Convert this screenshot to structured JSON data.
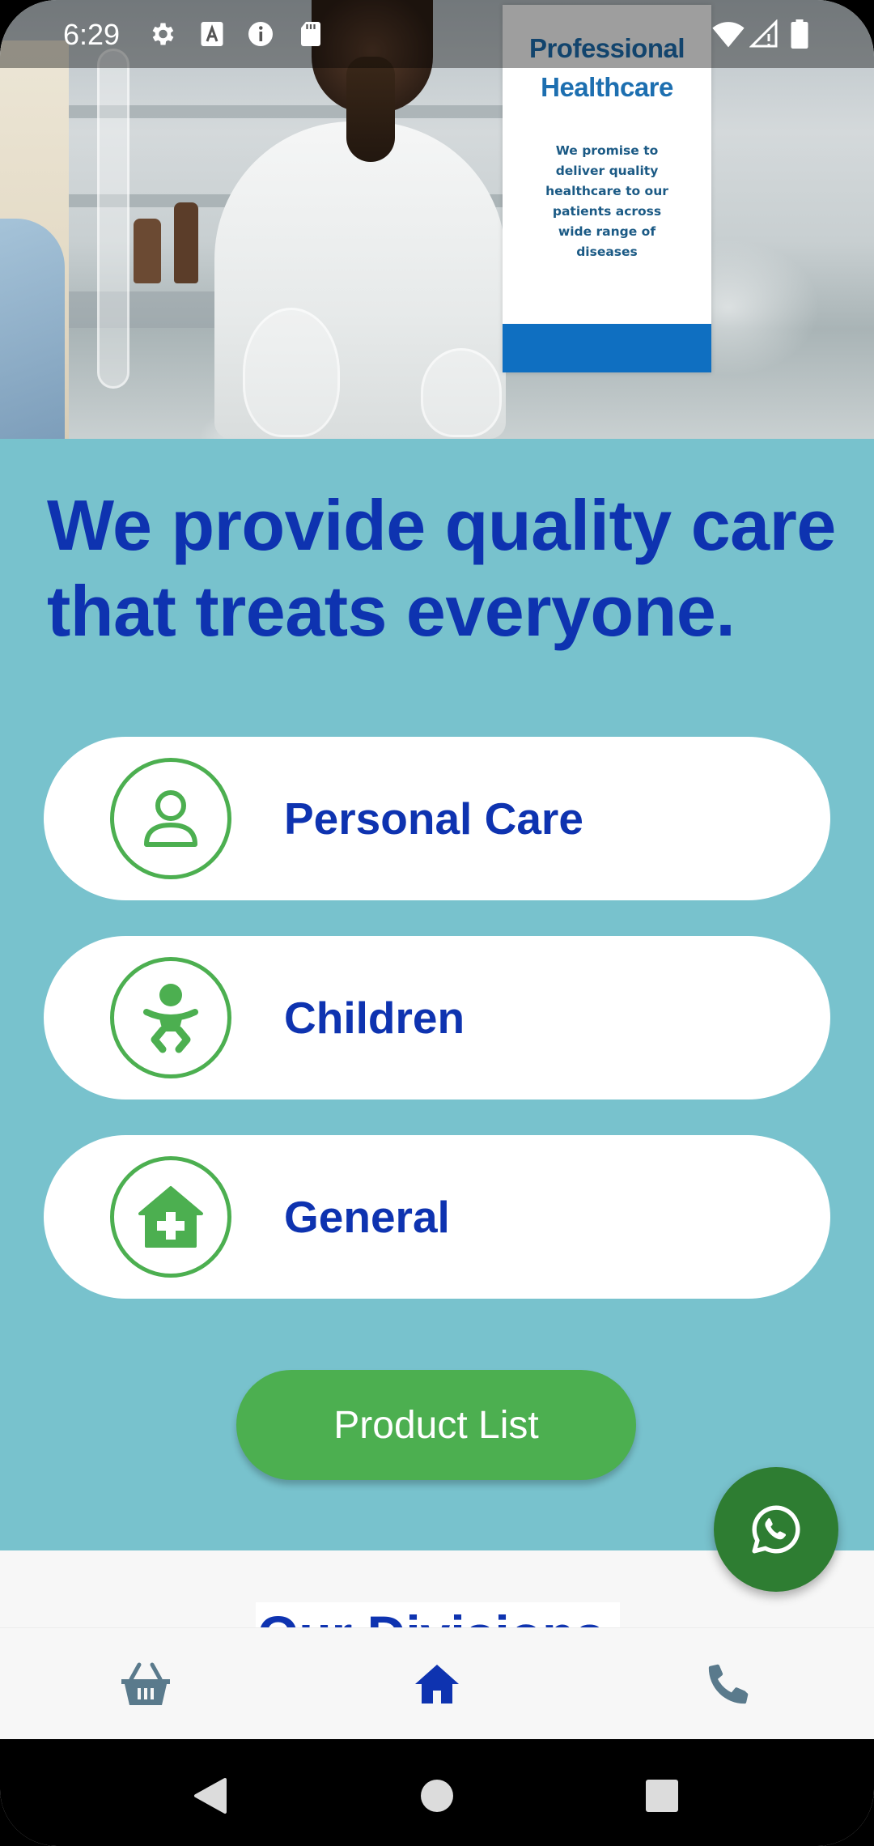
{
  "status_bar": {
    "time": "6:29",
    "icons": [
      "gear-icon",
      "a-text-icon",
      "info-icon",
      "sd-card-icon",
      "wifi-icon",
      "signal-icon",
      "battery-icon"
    ]
  },
  "hero": {
    "card_title_line1": "Professional",
    "card_title_line2": "Healthcare",
    "card_text": "We promise to deliver quality healthcare to our patients across wide range of diseases"
  },
  "headline": {
    "line1": "We provide quality care",
    "line2": "that treats everyone."
  },
  "categories": [
    {
      "label": "Personal Care",
      "icon": "person-icon"
    },
    {
      "label": "Children",
      "icon": "baby-icon"
    },
    {
      "label": "General",
      "icon": "medical-house-icon"
    }
  ],
  "product_button": {
    "label": "Product List"
  },
  "division": {
    "title": "Our Divisions"
  },
  "bottom_nav": {
    "items": [
      {
        "name": "basket",
        "icon": "basket-icon",
        "active": false
      },
      {
        "name": "home",
        "icon": "home-icon",
        "active": true
      },
      {
        "name": "phone",
        "icon": "phone-icon",
        "active": false
      }
    ]
  },
  "colors": {
    "teal_bg": "#78c2cd",
    "primary_blue": "#0e33b0",
    "green": "#4caf50",
    "fab_green": "#2e7d32",
    "nav_inactive": "#5a7a8c"
  }
}
